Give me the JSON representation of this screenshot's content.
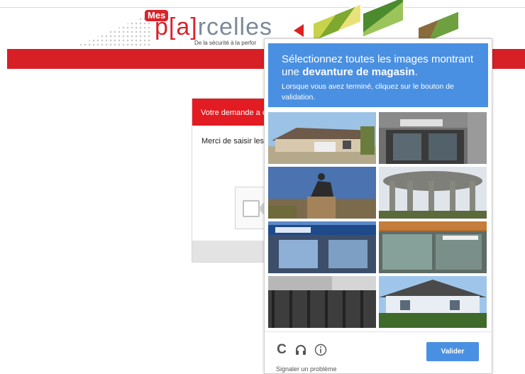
{
  "logo": {
    "mes": "Mes",
    "name_a": "p",
    "name_b": "rcelles",
    "tagline": "De la sécurité à la perfor"
  },
  "form": {
    "alert": "Votre demande a ex",
    "instruction": "Merci de saisir les"
  },
  "captcha": {
    "title_prefix": "Sélectionnez toutes les images montrant",
    "title_mid": "une ",
    "title_keyword": "devanture de magasin",
    "title_suffix": ".",
    "subtitle": "Lorsque vous avez terminé, cliquez sur le bouton de validation.",
    "verify_label": "Valider",
    "report_label": "Signaler un problème",
    "icons": [
      "reload-icon",
      "headphones-icon",
      "info-icon"
    ],
    "tiles": [
      "house-tile",
      "storefront-tile",
      "statue-tile",
      "colonnade-tile",
      "pharmacy-storefront-tile",
      "tabacos-storefront-tile",
      "fence-building-tile",
      "house-hedge-tile"
    ]
  },
  "colors": {
    "brand_red": "#d71f26",
    "captcha_blue": "#4a90e2"
  }
}
